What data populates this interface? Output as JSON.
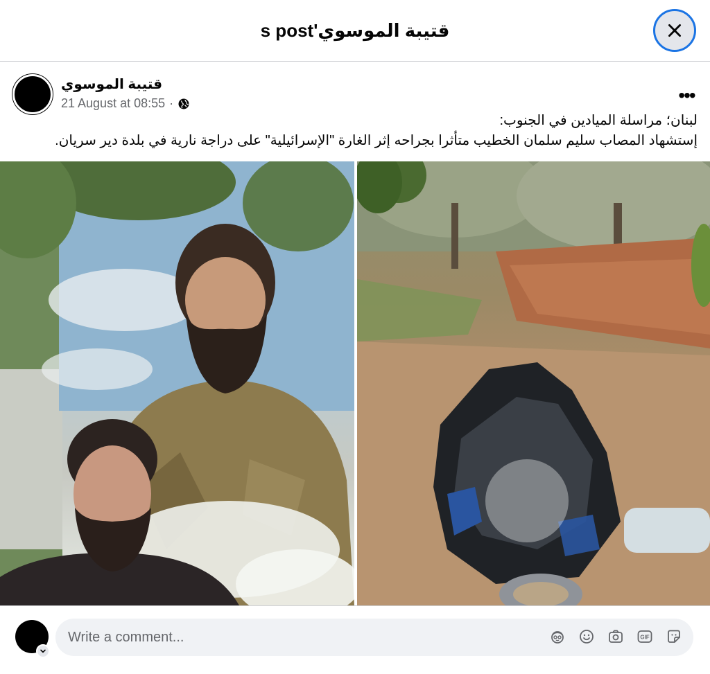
{
  "dialog": {
    "title": "قتيبة الموسوي's post",
    "close_label": "Close"
  },
  "post": {
    "author": "قتيبة الموسوي",
    "timestamp": "21 August at 08:55",
    "separator": "·",
    "privacy_icon": "globe-icon",
    "more_icon": "more-horizontal-icon",
    "text_line1": "لبنان؛ مراسلة الميادين في الجنوب:",
    "text_line2": "إستشهاد المصاب سليم  سلمان الخطيب متأثرا بجراحه إثر الغارة \"الإسرائيلية\" على دراجة نارية في بلدة دير سريان."
  },
  "media": {
    "photos": [
      {
        "name": "portrait-photo"
      },
      {
        "name": "burned-motorcycle-photo"
      }
    ]
  },
  "comment": {
    "placeholder": "Write a comment...",
    "icons": [
      "avatar-sticker-icon",
      "emoji-icon",
      "camera-icon",
      "gif-icon",
      "sticker-icon"
    ]
  },
  "colors": {
    "accent": "#1b74e4",
    "secondary_text": "#65676b",
    "input_bg": "#f0f2f5"
  }
}
